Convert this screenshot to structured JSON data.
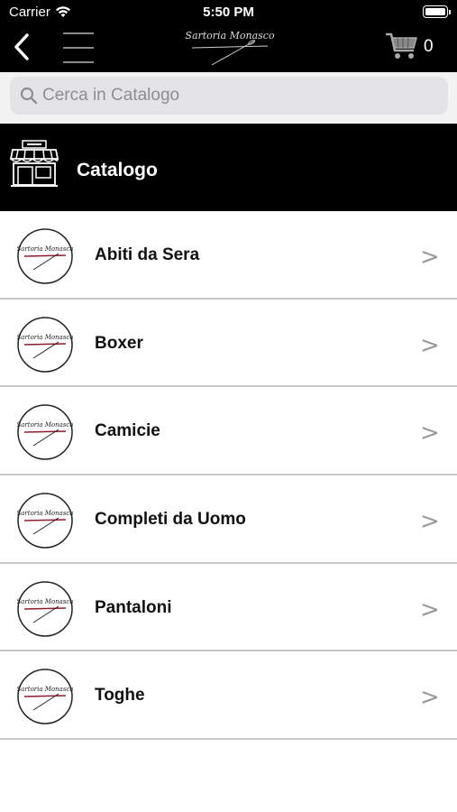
{
  "status_bar": {
    "carrier": "Carrier",
    "time": "5:50 PM"
  },
  "nav": {
    "logo_text": "Sartoria Monasco",
    "cart_count": "0"
  },
  "search": {
    "placeholder": "Cerca in Catalogo",
    "value": ""
  },
  "catalog": {
    "title": "Catalogo",
    "items": [
      {
        "label": "Abiti da Sera",
        "chevron": ">"
      },
      {
        "label": "Boxer",
        "chevron": ">"
      },
      {
        "label": "Camicie",
        "chevron": ">"
      },
      {
        "label": "Completi da Uomo",
        "chevron": ">"
      },
      {
        "label": "Pantaloni",
        "chevron": ">"
      },
      {
        "label": "Toghe",
        "chevron": ">"
      }
    ]
  },
  "colors": {
    "header_bg": "#000000",
    "row_divider": "#c8c8c8",
    "search_bg": "#e4e4e6",
    "accent_red": "#8b1e2d"
  }
}
